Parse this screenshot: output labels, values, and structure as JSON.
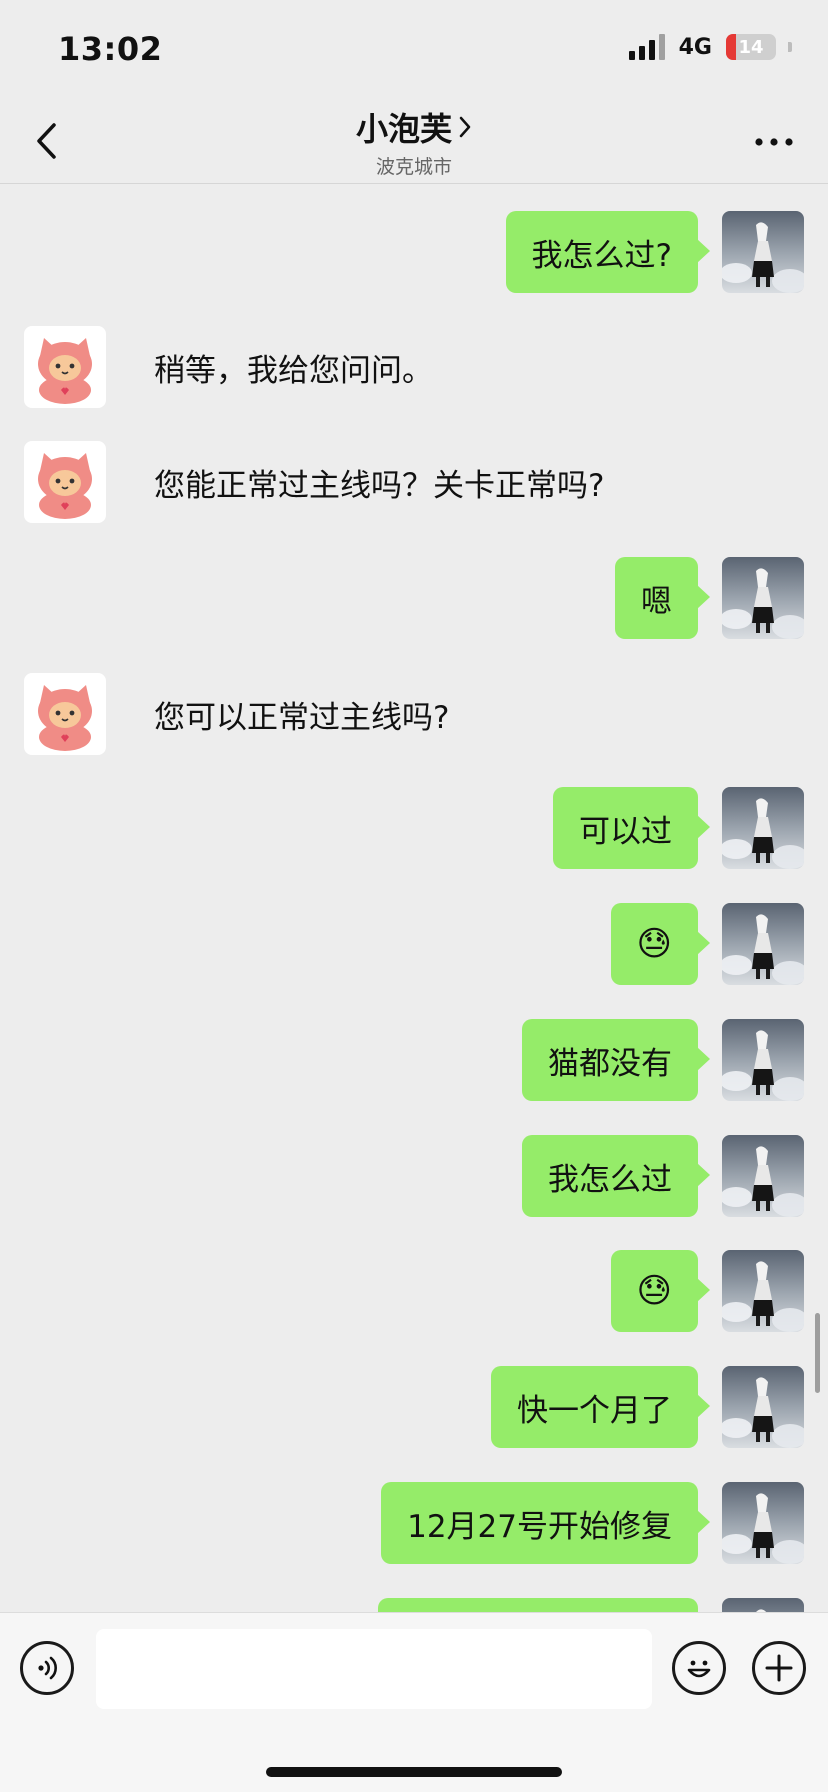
{
  "status_bar": {
    "time": "13:02",
    "network": "4G",
    "battery": "14"
  },
  "header": {
    "title": "小泡芙",
    "subtitle": "波克城市"
  },
  "colors": {
    "bubble_me": "#95ec69",
    "background": "#ededed",
    "battery_low": "#e53935"
  },
  "icons": {
    "back": "chevron-left-icon",
    "title_arrow": "chevron-right-icon",
    "more": "more-dots-icon",
    "voice": "voice-icon",
    "emoji": "smiley-icon",
    "plus": "plus-icon",
    "avatar_them": "pink-cat-avatar",
    "avatar_me": "user-photo-avatar"
  },
  "messages": [
    {
      "from": "me",
      "text": "我怎么过?"
    },
    {
      "from": "them",
      "text": "稍等，我给您问问。"
    },
    {
      "from": "them",
      "text": "您能正常过主线吗？关卡正常吗?"
    },
    {
      "from": "me",
      "text": "嗯"
    },
    {
      "from": "them",
      "text": "您可以正常过主线吗?"
    },
    {
      "from": "me",
      "text": "可以过"
    },
    {
      "from": "me",
      "text": "😓"
    },
    {
      "from": "me",
      "text": "猫都没有"
    },
    {
      "from": "me",
      "text": "我怎么过"
    },
    {
      "from": "me",
      "text": "😓"
    },
    {
      "from": "me",
      "text": "快一个月了"
    },
    {
      "from": "me",
      "text": "12月27号开始修复"
    },
    {
      "from": "me",
      "text": ""
    }
  ],
  "input": {
    "value": "",
    "placeholder": ""
  }
}
